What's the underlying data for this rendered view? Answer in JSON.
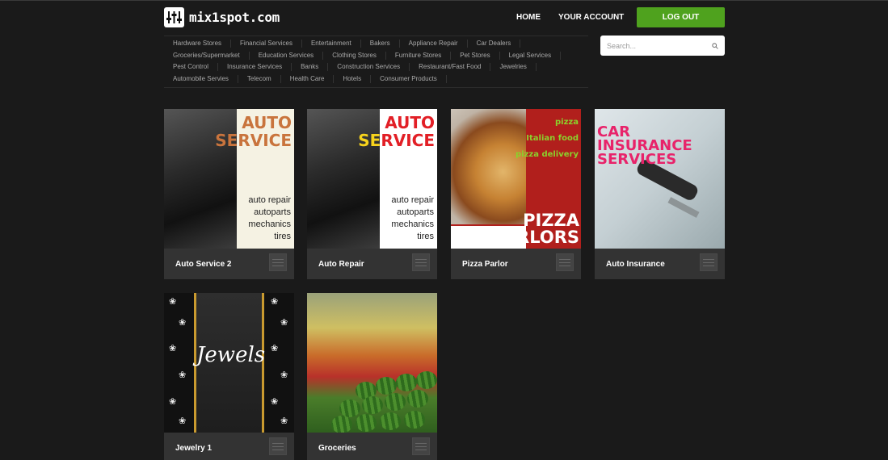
{
  "site": {
    "name": "mix1spot.com"
  },
  "nav": {
    "home": "HOME",
    "account": "YOUR ACCOUNT",
    "logout": "LOG OUT"
  },
  "search": {
    "placeholder": "Search..."
  },
  "categories": [
    [
      "Hardware Stores",
      "Financial Services",
      "Entertainment",
      "Bakers",
      "Appliance Repair",
      "Car Dealers"
    ],
    [
      "Groceries/Supermarket",
      "Education Services",
      "Clothing Stores",
      "Furniture Stores",
      "Pet Stores",
      "Legal Services"
    ],
    [
      "Pest Control",
      "Insurance Services",
      "Banks",
      "Construction Services",
      "Restaurant/Fast Food",
      "Jewelries"
    ],
    [
      "Automobile Servies",
      "Telecom",
      "Health Care",
      "Hotels",
      "Consumer Products"
    ]
  ],
  "cards": [
    {
      "title": "Auto Service 2",
      "image": {
        "headline_1": "AUTO",
        "headline_2": "SERVICE",
        "lines": [
          "auto repair",
          "autoparts",
          "mechanics",
          "tires"
        ]
      }
    },
    {
      "title": "Auto Repair",
      "image": {
        "headline_1": "AUTO",
        "headline_2": "SERVICE",
        "lines": [
          "auto repair",
          "autoparts",
          "mechanics",
          "tires"
        ]
      }
    },
    {
      "title": "Pizza Parlor",
      "image": {
        "tags": [
          "pizza",
          "Italian food",
          "pizza delivery"
        ],
        "headline_1": "PIZZA",
        "headline_2": "PARLORS"
      }
    },
    {
      "title": "Auto Insurance",
      "image": {
        "lines": [
          "CAR",
          "INSURANCE",
          "SERVICES"
        ]
      }
    },
    {
      "title": "Jewelry 1",
      "image": {
        "headline": "Jewels"
      }
    },
    {
      "title": "Groceries",
      "image": {}
    }
  ],
  "colors": {
    "accent": "#4fa21e",
    "background": "#1a1a1a",
    "card": "#333333",
    "pizza_red": "#b11f1c",
    "insurance_pink": "#e8236a"
  }
}
